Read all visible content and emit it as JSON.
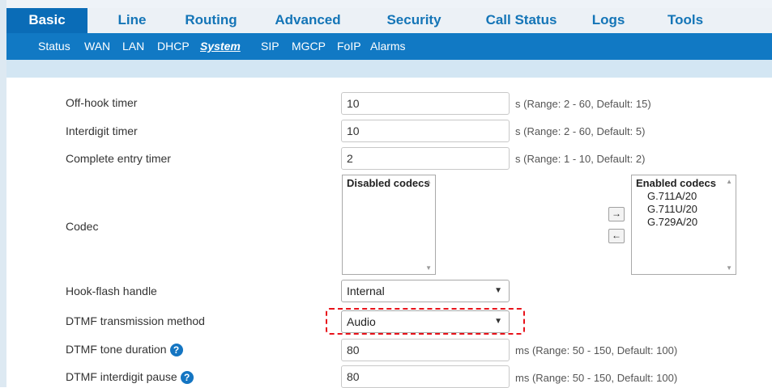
{
  "nav": {
    "tabs": [
      "Basic",
      "Line",
      "Routing",
      "Advanced",
      "Security",
      "Call Status",
      "Logs",
      "Tools"
    ],
    "active_tab": "Basic"
  },
  "subnav": {
    "items": [
      "Status",
      "WAN",
      "LAN",
      "DHCP",
      "System",
      "SIP",
      "MGCP",
      "FoIP",
      "Alarms"
    ],
    "active_item": "System"
  },
  "form": {
    "offhook": {
      "label": "Off-hook timer",
      "value": "10",
      "hint": "s (Range: 2 - 60, Default: 15)"
    },
    "interdigit": {
      "label": "Interdigit timer",
      "value": "10",
      "hint": "s (Range: 2 - 60, Default: 5)"
    },
    "complete_entry": {
      "label": "Complete entry timer",
      "value": "2",
      "hint": "s (Range: 1 - 10, Default: 2)"
    },
    "codec": {
      "label": "Codec",
      "disabled_header": "Disabled codecs",
      "disabled_items": [],
      "enabled_header": "Enabled codecs",
      "enabled_items": [
        "G.711A/20",
        "G.711U/20",
        "G.729A/20"
      ],
      "move_right": "→",
      "move_left": "←"
    },
    "hookflash": {
      "label": "Hook-flash handle",
      "value": "Internal"
    },
    "dtmf_method": {
      "label": "DTMF transmission method",
      "value": "Audio"
    },
    "dtmf_duration": {
      "label": "DTMF tone duration",
      "value": "80",
      "hint": "ms (Range: 50 - 150, Default: 100)"
    },
    "dtmf_pause": {
      "label": "DTMF interdigit pause",
      "value": "80",
      "hint": "ms (Range: 50 - 150, Default: 100)"
    }
  },
  "icons": {
    "help": "question-circle-icon",
    "dropdown": "caret-down-icon"
  },
  "colors": {
    "brand_blue": "#1179c4",
    "active_tab": "#0a6cb7",
    "highlight": "#e8121a"
  }
}
